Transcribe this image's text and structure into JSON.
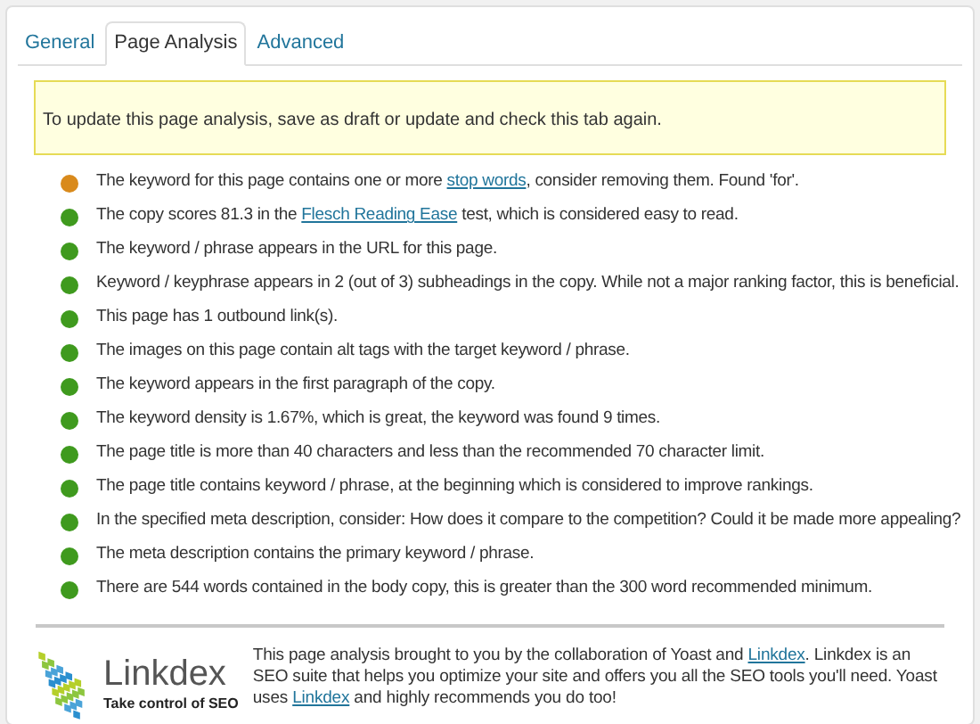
{
  "tabs": [
    {
      "label": "General",
      "selected": false
    },
    {
      "label": "Page Analysis",
      "selected": true
    },
    {
      "label": "Advanced",
      "selected": false
    }
  ],
  "notice": "To update this page analysis, save as draft or update and check this tab again.",
  "results": [
    {
      "color": "#d98a1c",
      "parts": [
        {
          "text": "The keyword for this page contains one or more "
        },
        {
          "text": "stop words",
          "link": true
        },
        {
          "text": ", consider removing them. Found 'for'."
        }
      ]
    },
    {
      "color": "#3f9a1e",
      "parts": [
        {
          "text": "The copy scores 81.3 in the "
        },
        {
          "text": "Flesch Reading Ease",
          "link": true
        },
        {
          "text": " test, which is considered easy to read."
        }
      ]
    },
    {
      "color": "#3f9a1e",
      "parts": [
        {
          "text": "The keyword / phrase appears in the URL for this page."
        }
      ]
    },
    {
      "color": "#3f9a1e",
      "parts": [
        {
          "text": "Keyword / keyphrase appears in 2 (out of 3) subheadings in the copy. While not a major ranking factor, this is beneficial."
        }
      ]
    },
    {
      "color": "#3f9a1e",
      "parts": [
        {
          "text": "This page has 1 outbound link(s)."
        }
      ]
    },
    {
      "color": "#3f9a1e",
      "parts": [
        {
          "text": "The images on this page contain alt tags with the target keyword / phrase."
        }
      ]
    },
    {
      "color": "#3f9a1e",
      "parts": [
        {
          "text": "The keyword appears in the first paragraph of the copy."
        }
      ]
    },
    {
      "color": "#3f9a1e",
      "parts": [
        {
          "text": "The keyword density is 1.67%, which is great, the keyword was found 9 times."
        }
      ]
    },
    {
      "color": "#3f9a1e",
      "parts": [
        {
          "text": "The page title is more than 40 characters and less than the recommended 70 character limit."
        }
      ]
    },
    {
      "color": "#3f9a1e",
      "parts": [
        {
          "text": "The page title contains keyword / phrase, at the beginning which is considered to improve rankings."
        }
      ]
    },
    {
      "color": "#3f9a1e",
      "parts": [
        {
          "text": "In the specified meta description, consider: How does it compare to the competition? Could it be made more appealing?"
        }
      ]
    },
    {
      "color": "#3f9a1e",
      "parts": [
        {
          "text": "The meta description contains the primary keyword / phrase."
        }
      ]
    },
    {
      "color": "#3f9a1e",
      "parts": [
        {
          "text": "There are 544 words contained in the body copy, this is greater than the 300 word recommended minimum."
        }
      ]
    }
  ],
  "footer": {
    "logo_name": "Linkdex",
    "logo_tagline": "Take control of SEO",
    "parts": [
      {
        "text": "This page analysis brought to you by the collaboration of Yoast and "
      },
      {
        "text": "Linkdex",
        "link": true
      },
      {
        "text": ". Linkdex is an SEO suite that helps you optimize your site and offers you all the SEO tools you'll need. Yoast uses "
      },
      {
        "text": "Linkdex",
        "link": true
      },
      {
        "text": " and highly recommends you do too!"
      }
    ]
  }
}
